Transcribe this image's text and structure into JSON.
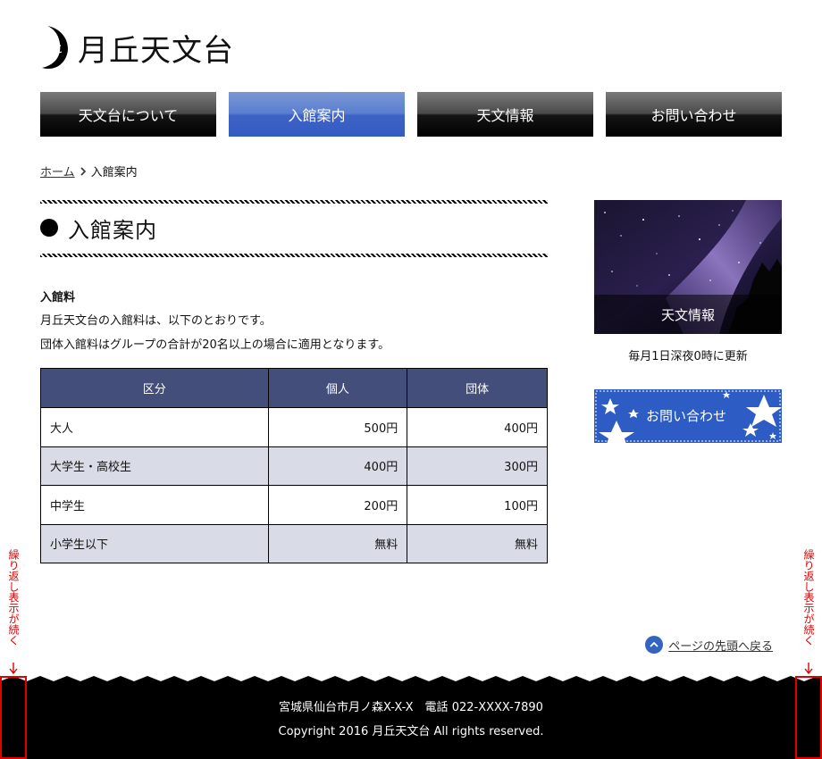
{
  "header": {
    "logo_text": "月丘天文台"
  },
  "nav": [
    {
      "label": "天文台について",
      "active": false
    },
    {
      "label": "入館案内",
      "active": true
    },
    {
      "label": "天文情報",
      "active": false
    },
    {
      "label": "お問い合わせ",
      "active": false
    }
  ],
  "breadcrumb": {
    "home": "ホーム",
    "current": "入館案内"
  },
  "page": {
    "title": "入館案内"
  },
  "content": {
    "section_heading": "入館料",
    "intro_1": "月丘天文台の入館料は、以下のとおりです。",
    "intro_2": "団体入館料はグループの合計が20名以上の場合に適用となります。"
  },
  "table": {
    "headers": [
      "区分",
      "個人",
      "団体"
    ],
    "rows": [
      [
        "大人",
        "500円",
        "400円"
      ],
      [
        "大学生・高校生",
        "400円",
        "300円"
      ],
      [
        "中学生",
        "200円",
        "100円"
      ],
      [
        "小学生以下",
        "無料",
        "無料"
      ]
    ]
  },
  "sidebar": {
    "banner_label": "天文情報",
    "banner_note": "毎月1日深夜0時に更新",
    "contact_label": "お問い合わせ"
  },
  "back_to_top": "ページの先頭へ戻る",
  "footer": {
    "address": "宮城県仙台市月ノ森X-X-X　電話 022-XXXX-7890",
    "copyright": "Copyright 2016 月丘天文台 All rights reserved."
  },
  "annotation": {
    "repeat_text": "繰り返し表示が続く"
  },
  "colors": {
    "nav_active": "#3e63c6",
    "table_header": "#444e7a",
    "table_alt_row": "#d9dce6",
    "annotation": "#e00000"
  }
}
